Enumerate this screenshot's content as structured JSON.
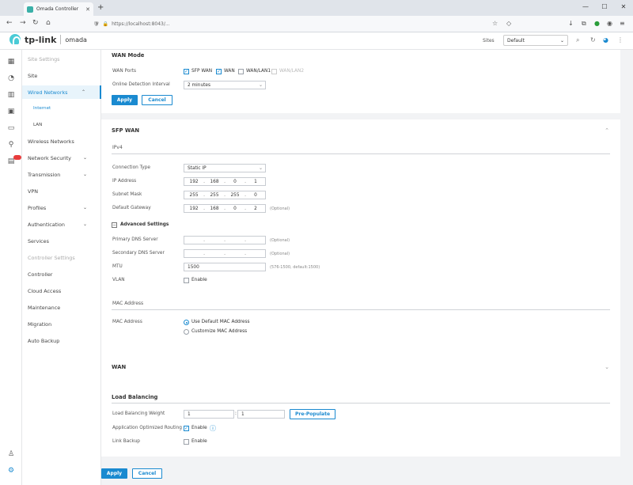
{
  "browser": {
    "tab_title": "Omada Controller",
    "url": "https://localhost:8043/...",
    "window_min": "—",
    "window_max": "☐",
    "window_close": "✕"
  },
  "header": {
    "logo_tplink": "tp-link",
    "logo_omada": "omada",
    "site_label": "Sites",
    "site_value": "Default"
  },
  "sidebar": {
    "items": [
      {
        "label": "Site Settings",
        "style": "grey"
      },
      {
        "label": "Site"
      },
      {
        "label": "Wired Networks",
        "active": true,
        "chev": "^"
      },
      {
        "label": "Internet",
        "sub": true,
        "selected": true
      },
      {
        "label": "LAN",
        "sub": true
      },
      {
        "label": "Wireless Networks"
      },
      {
        "label": "Network Security",
        "chev": "v"
      },
      {
        "label": "Transmission",
        "chev": "v"
      },
      {
        "label": "VPN"
      },
      {
        "label": "Profiles",
        "chev": "v"
      },
      {
        "label": "Authentication",
        "chev": "v"
      },
      {
        "label": "Services"
      },
      {
        "label": "Controller Settings",
        "style": "grey"
      },
      {
        "label": "Controller"
      },
      {
        "label": "Cloud Access"
      },
      {
        "label": "Maintenance"
      },
      {
        "label": "Migration"
      },
      {
        "label": "Auto Backup"
      }
    ]
  },
  "wan_mode": {
    "title": "WAN Mode",
    "ports_label": "WAN Ports",
    "ports": [
      {
        "label": "SFP WAN",
        "checked": true
      },
      {
        "label": "WAN",
        "checked": true
      },
      {
        "label": "WAN/LAN1",
        "checked": false
      },
      {
        "label": "WAN/LAN2",
        "checked": false,
        "disabled": true
      }
    ],
    "detect_label": "Online Detection Interval",
    "detect_value": "2 minutes",
    "apply": "Apply",
    "cancel": "Cancel"
  },
  "sfp_wan": {
    "title": "SFP WAN",
    "ipv4": "IPv4",
    "conn_type_label": "Connection Type",
    "conn_type_value": "Static IP",
    "ip_label": "IP Address",
    "ip": [
      "192",
      "168",
      "0",
      "1"
    ],
    "mask_label": "Subnet Mask",
    "mask": [
      "255",
      "255",
      "255",
      "0"
    ],
    "gw_label": "Default Gateway",
    "gw": [
      "192",
      "168",
      "0",
      "2"
    ],
    "optional": "(Optional)",
    "adv_toggle": "−",
    "adv_title": "Advanced Settings",
    "dns1_label": "Primary DNS Server",
    "dns2_label": "Secondary DNS Server",
    "mtu_label": "MTU",
    "mtu_value": "1500",
    "mtu_hint": "(576-1500, default:1500)",
    "vlan_label": "VLAN",
    "enable": "Enable",
    "mac_title": "MAC Address",
    "mac_label": "MAC Address",
    "mac_default": "Use Default MAC Address",
    "mac_custom": "Customize MAC Address"
  },
  "wan": {
    "title": "WAN"
  },
  "load_balancing": {
    "title": "Load Balancing",
    "weight_label": "Load Balancing Weight",
    "weight1": "1",
    "weight2": "1",
    "prepopulate": "Pre-Populate",
    "aor_label": "Application Optimized Routing",
    "enable": "Enable",
    "backup_label": "Link Backup"
  },
  "footer": {
    "apply": "Apply",
    "cancel": "Cancel"
  }
}
